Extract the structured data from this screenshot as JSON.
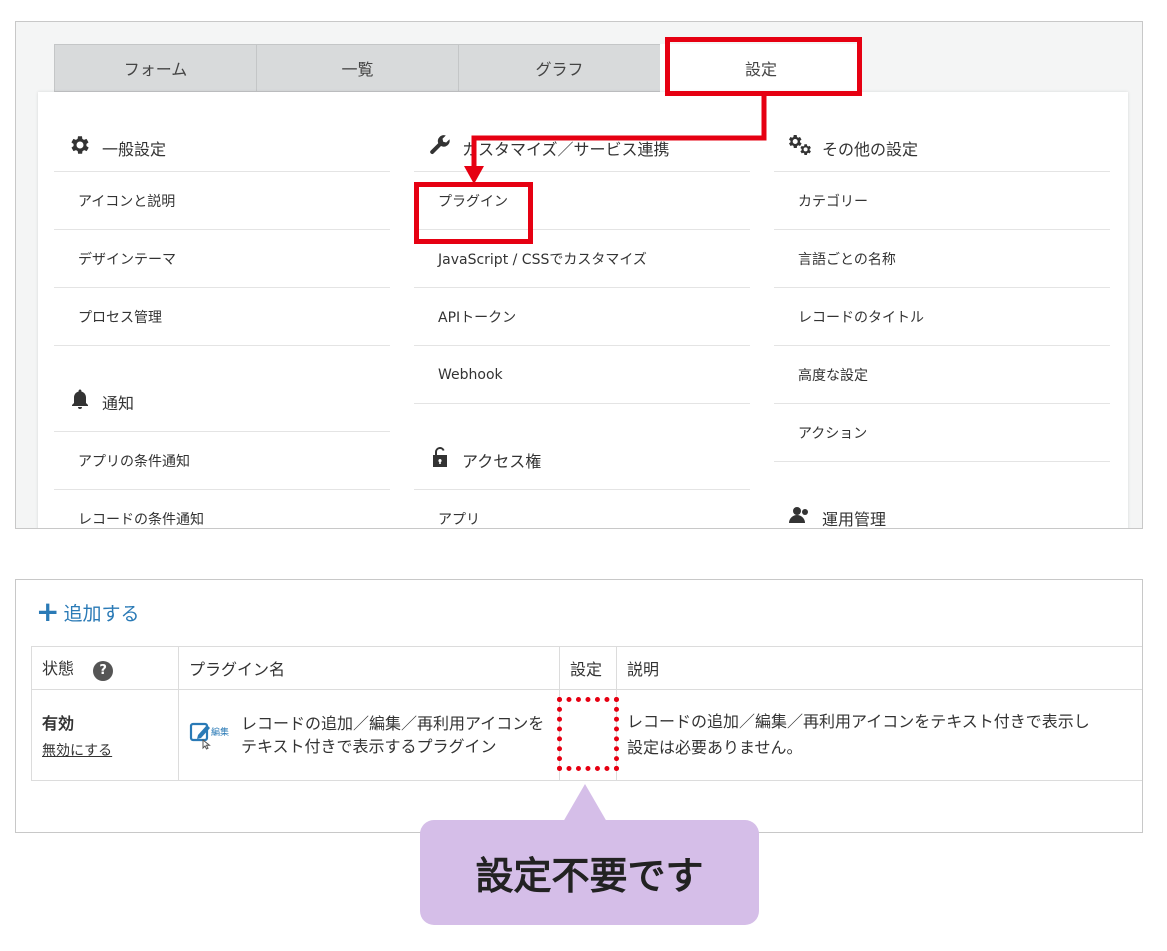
{
  "tabs": [
    {
      "label": "フォーム"
    },
    {
      "label": "一覧"
    },
    {
      "label": "グラフ"
    },
    {
      "label": "設定",
      "active": true
    }
  ],
  "settings": {
    "general": {
      "title": "一般設定",
      "icon": "gear-icon",
      "items": [
        "アイコンと説明",
        "デザインテーマ",
        "プロセス管理"
      ]
    },
    "notification": {
      "title": "通知",
      "icon": "bell-icon",
      "items": [
        "アプリの条件通知",
        "レコードの条件通知"
      ]
    },
    "customize": {
      "title": "カスタマイズ／サービス連携",
      "icon": "wrench-icon",
      "items": [
        "プラグイン",
        "JavaScript / CSSでカスタマイズ",
        "APIトークン",
        "Webhook"
      ]
    },
    "access": {
      "title": "アクセス権",
      "icon": "unlock-icon",
      "items": [
        "アプリ"
      ]
    },
    "other": {
      "title": "その他の設定",
      "icon": "gears-icon",
      "items": [
        "カテゴリー",
        "言語ごとの名称",
        "レコードのタイトル",
        "高度な設定",
        "アクション"
      ]
    },
    "operation": {
      "title": "運用管理",
      "icon": "people-icon"
    }
  },
  "plugins": {
    "add_label": "追加する",
    "headers": {
      "status": "状態",
      "name": "プラグイン名",
      "settings": "設定",
      "description": "説明"
    },
    "rows": [
      {
        "status": "有効",
        "toggle_label": "無効にする",
        "icon_badge": "編集",
        "name": "レコードの追加／編集／再利用アイコンをテキスト付きで表示するプラグイン",
        "description_line1": "レコードの追加／編集／再利用アイコンをテキスト付きで表示し",
        "description_line2": "設定は必要ありません。"
      }
    ]
  },
  "callout": {
    "text": "設定不要です",
    "color": "#d5bee8"
  },
  "colors": {
    "highlight": "#e60012",
    "link": "#2a7ab6"
  }
}
